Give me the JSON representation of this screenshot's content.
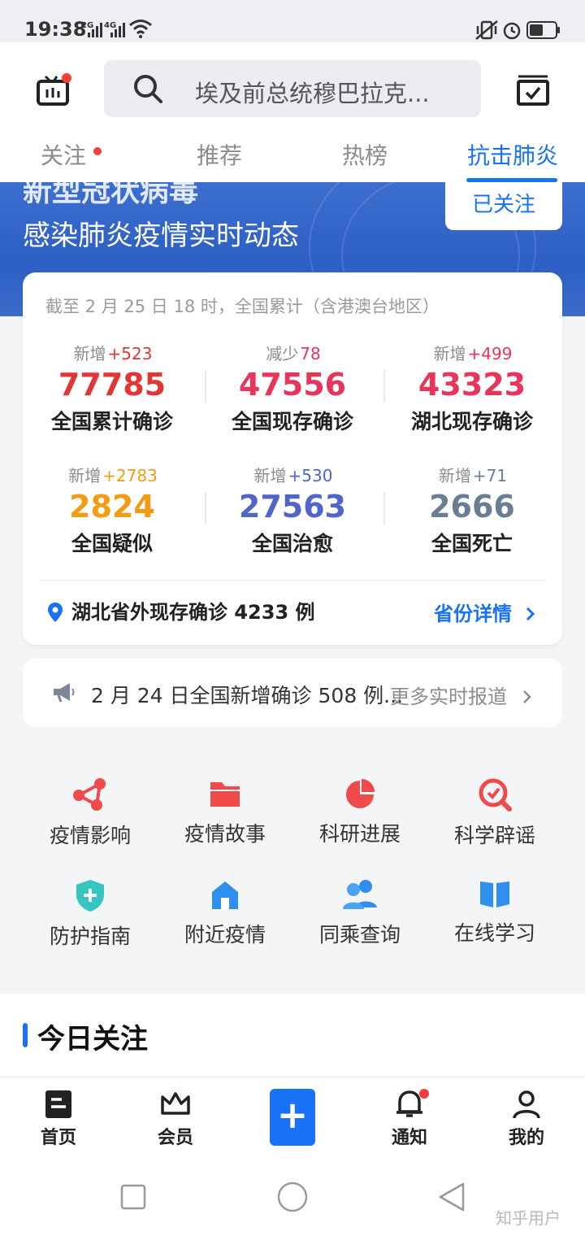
{
  "status_bar": {
    "time": "19:38",
    "sig1": "2G",
    "sig2": "4G"
  },
  "header": {
    "search_text": "埃及前总统穆巴拉克..."
  },
  "tabs": [
    {
      "label": "关注",
      "active": false,
      "dot": true
    },
    {
      "label": "推荐",
      "active": false
    },
    {
      "label": "热榜",
      "active": false
    },
    {
      "label": "抗击肺炎",
      "active": true
    }
  ],
  "banner": {
    "title_line1": "新型冠状病毒",
    "title_line2": "感染肺炎疫情实时动态",
    "follow_label": "已关注"
  },
  "stats": {
    "note": "截至 2 月 25 日 18 时，全国累计（含港澳台地区）",
    "items": [
      {
        "delta_label": "新增",
        "delta": "+523",
        "value": "77785",
        "label": "全国累计确诊",
        "color": "#e03636",
        "delta_color": "#e03636"
      },
      {
        "delta_label": "减少",
        "delta": "78",
        "value": "47556",
        "label": "全国现存确诊",
        "color": "#e8355b",
        "delta_color": "#e8355b"
      },
      {
        "delta_label": "新增",
        "delta": "+499",
        "value": "43323",
        "label": "湖北现存确诊",
        "color": "#e8355b",
        "delta_color": "#e8355b"
      },
      {
        "delta_label": "新增",
        "delta": "+2783",
        "value": "2824",
        "label": "全国疑似",
        "color": "#f39c12",
        "delta_color": "#f39c12"
      },
      {
        "delta_label": "新增",
        "delta": "+530",
        "value": "27563",
        "label": "全国治愈",
        "color": "#5165c8",
        "delta_color": "#5165c8"
      },
      {
        "delta_label": "新增",
        "delta": "+71",
        "value": "2666",
        "label": "全国死亡",
        "color": "#6b7d93",
        "delta_color": "#6b7d93"
      }
    ],
    "outside_hubei": "湖北省外现存确诊 4233 例",
    "province_link": "省份详情"
  },
  "news": {
    "text": "2 月 24 日全国新增确诊 508 例...",
    "more": "更多实时报道"
  },
  "features": [
    {
      "label": "疫情影响",
      "icon": "impact-icon"
    },
    {
      "label": "疫情故事",
      "icon": "folder-icon"
    },
    {
      "label": "科研进展",
      "icon": "pie-icon"
    },
    {
      "label": "科学辟谣",
      "icon": "magnifier-icon"
    },
    {
      "label": "防护指南",
      "icon": "shield-icon"
    },
    {
      "label": "附近疫情",
      "icon": "home-icon"
    },
    {
      "label": "同乘查询",
      "icon": "people-icon"
    },
    {
      "label": "在线学习",
      "icon": "book-icon"
    }
  ],
  "today": {
    "title": "今日关注"
  },
  "bottom_nav": [
    {
      "label": "首页"
    },
    {
      "label": "会员"
    },
    {
      "label": ""
    },
    {
      "label": "通知"
    },
    {
      "label": "我的"
    }
  ],
  "watermark": "知乎用户",
  "colors": {
    "accent": "#1772f6",
    "red": "#f1403c"
  }
}
